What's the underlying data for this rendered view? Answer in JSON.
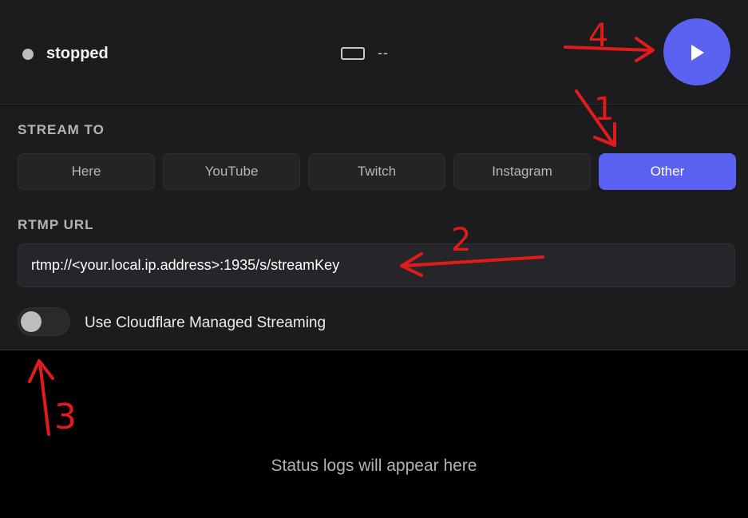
{
  "status": {
    "text": "stopped",
    "dot_color": "#bdbdbd"
  },
  "resolution": {
    "icon": "screen-icon",
    "text": "--"
  },
  "controls": {
    "play_icon": "play-icon",
    "accent_color": "#5b61f0"
  },
  "stream_to": {
    "label": "STREAM TO",
    "options": [
      {
        "label": "Here"
      },
      {
        "label": "YouTube"
      },
      {
        "label": "Twitch"
      },
      {
        "label": "Instagram"
      },
      {
        "label": "Other"
      }
    ],
    "selected": "Other"
  },
  "rtmp": {
    "label": "RTMP URL",
    "value": "rtmp://<your.local.ip.address>:1935/s/streamKey"
  },
  "cloudflare": {
    "label": "Use Cloudflare Managed Streaming",
    "enabled": false
  },
  "logs": {
    "placeholder": "Status logs will appear here"
  },
  "annotations": {
    "color": "#e01b1b",
    "numbers": [
      "1",
      "2",
      "3",
      "4"
    ]
  }
}
